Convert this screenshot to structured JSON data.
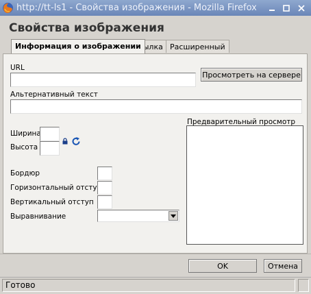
{
  "window": {
    "title": "http://tt-ls1 - Свойства изображения - Mozilla Firefox",
    "icons": [
      "firefox-icon",
      "minimize-icon",
      "maximize-icon",
      "close-icon"
    ]
  },
  "dialog": {
    "title": "Свойства изображения",
    "tabs": [
      {
        "label": "Информация о изображении",
        "active": true
      },
      {
        "label": "Ссылка",
        "active": false
      },
      {
        "label": "Расширенный",
        "active": false
      }
    ]
  },
  "form": {
    "url_label": "URL",
    "url_value": "",
    "browse_server_label": "Просмотреть на сервере",
    "alt_label": "Альтернативный текст",
    "alt_value": "",
    "width_label": "Ширина",
    "width_value": "",
    "height_label": "Высота",
    "height_value": "",
    "lock_icon": "lock-icon",
    "reset_icon": "reset-size-icon",
    "preview_label": "Предварительный просмотр",
    "border_label": "Бордюр",
    "border_value": "",
    "hspace_label": "Горизонтальный отступ",
    "hspace_value": "",
    "vspace_label": "Вертикальный отступ",
    "vspace_value": "",
    "align_label": "Выравнивание",
    "align_value": ""
  },
  "buttons": {
    "ok": "OK",
    "cancel": "Отмена"
  },
  "statusbar": {
    "text": "Готово"
  },
  "colors": {
    "titlebar_start": "#8fa8cf",
    "titlebar_end": "#6a86b8",
    "dialog_bg": "#d6d3ce",
    "panel_bg": "#f2f1ee"
  }
}
